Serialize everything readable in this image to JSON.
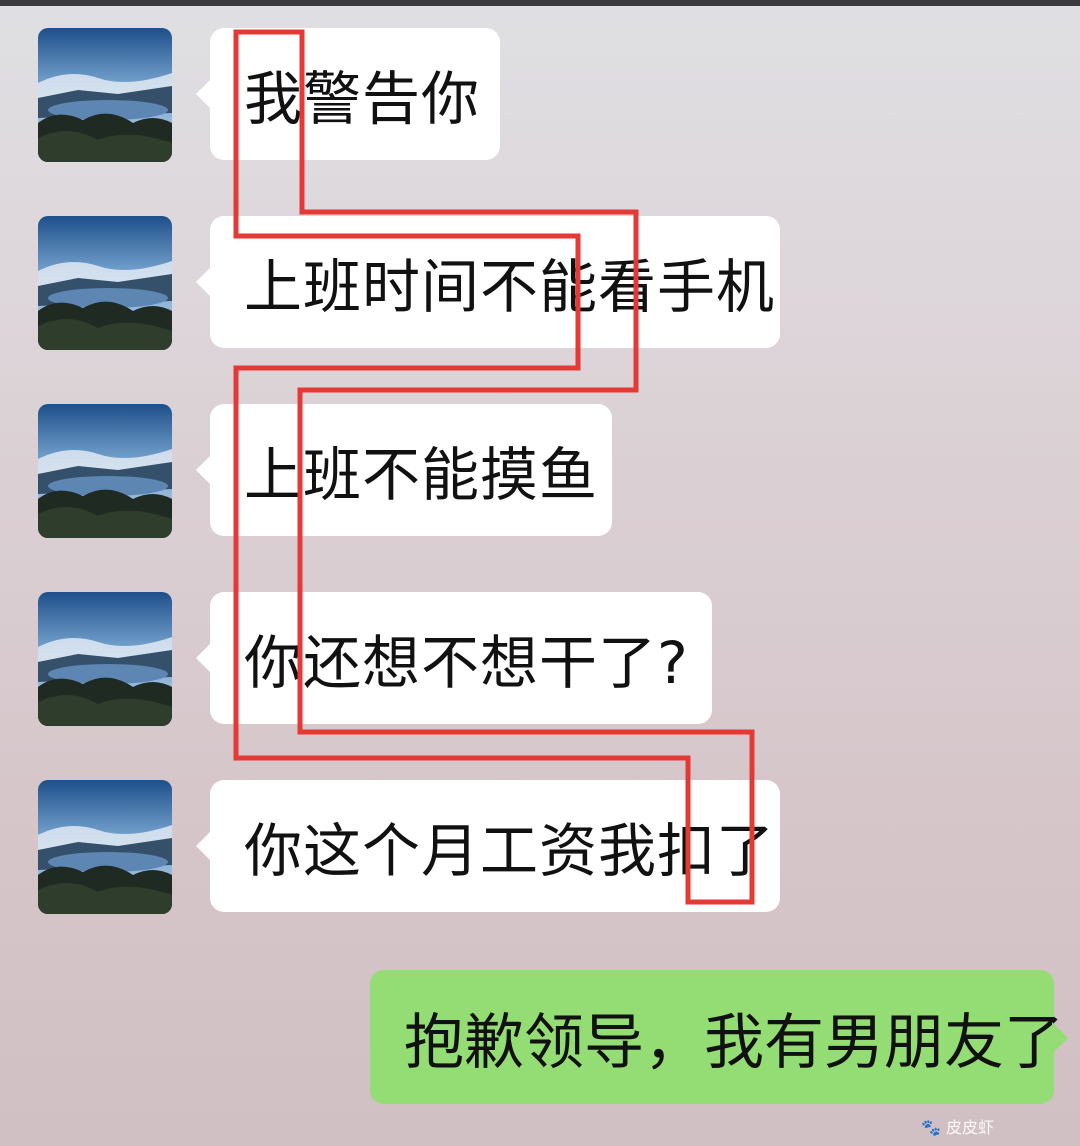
{
  "messages": [
    {
      "from": "other",
      "text": "我警告你"
    },
    {
      "from": "other",
      "text": "上班时间不能看手机"
    },
    {
      "from": "other",
      "text": "上班不能摸鱼"
    },
    {
      "from": "other",
      "text": "你还想不想干了?"
    },
    {
      "from": "other",
      "text": "你这个月工资我扣了"
    },
    {
      "from": "self",
      "text": "抱歉领导，我有男朋友了"
    }
  ],
  "annotation": {
    "color": "#e53935",
    "description": "red outline snaking through the first character of each message"
  },
  "watermark": {
    "text": "皮皮虾"
  },
  "colors": {
    "self_bubble": "#94dc74",
    "other_bubble": "#ffffff"
  }
}
